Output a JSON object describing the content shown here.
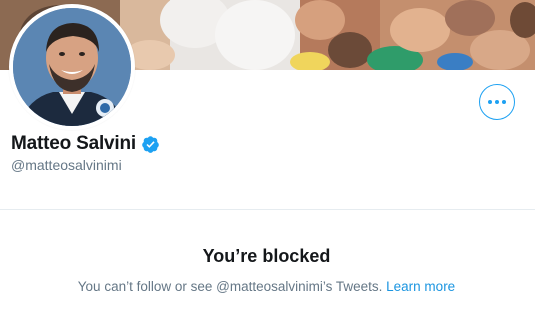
{
  "profile": {
    "display_name": "Matteo Salvini",
    "handle": "@matteosalvinimi",
    "verified": true
  },
  "icons": {
    "verified": "verified-badge-icon",
    "more": "more-horizontal-icon"
  },
  "blocked": {
    "title": "You’re blocked",
    "message": "You can’t follow or see @matteosalvinimi’s Tweets.",
    "learn_more": "Learn more"
  },
  "colors": {
    "accent": "#1da1f2",
    "link": "#1b95e0",
    "text_primary": "#14171a",
    "text_secondary": "#657786",
    "divider": "#e6ecf0"
  }
}
